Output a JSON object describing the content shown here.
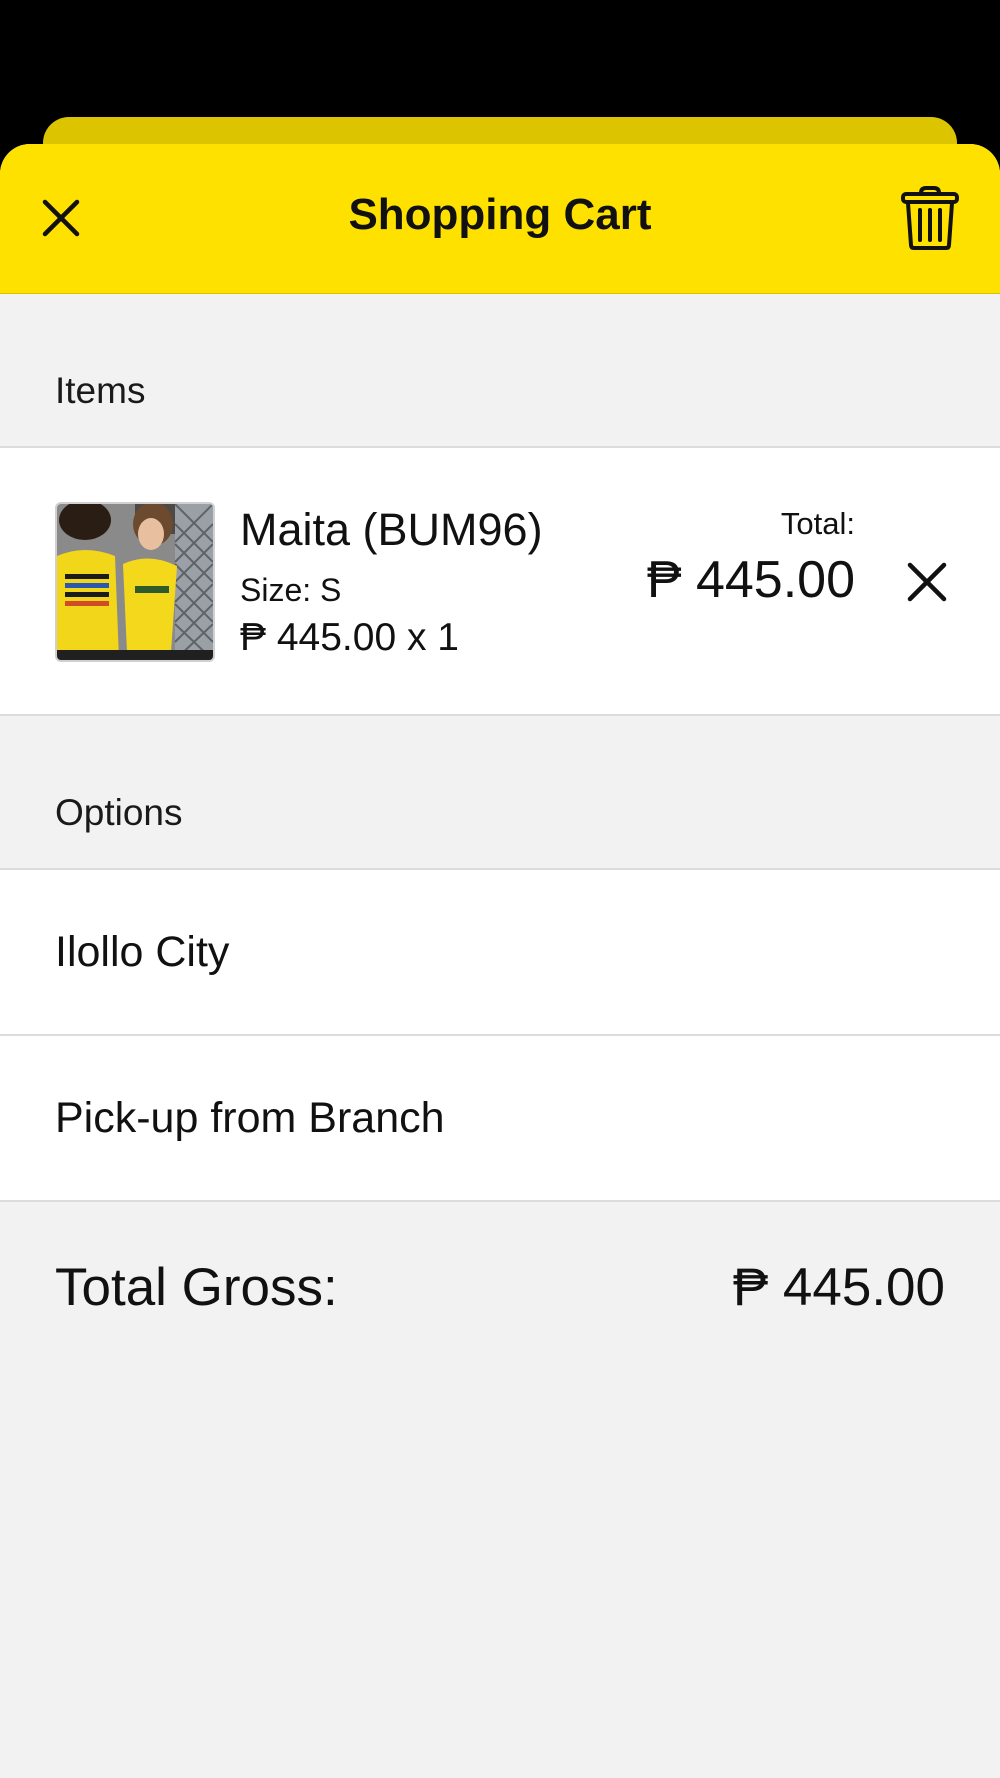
{
  "header": {
    "title": "Shopping Cart"
  },
  "items_section": {
    "label": "Items"
  },
  "cart_items": [
    {
      "name": "Maita (BUM96)",
      "size": "Size: S",
      "price_qty": "₱ 445.00 x 1",
      "total_label": "Total:",
      "total_value": "₱ 445.00"
    }
  ],
  "options_section": {
    "label": "Options",
    "rows": [
      "Ilollo City",
      "Pick-up from Branch"
    ]
  },
  "summary": {
    "gross_label": "Total Gross:",
    "gross_value": "₱ 445.00"
  },
  "colors": {
    "accent": "#ffe100",
    "accent_dark": "#dcc500",
    "background": "#f2f2f2",
    "card": "#ffffff",
    "text": "#111111"
  },
  "icons": [
    "close-icon",
    "trash-icon",
    "remove-item-icon"
  ]
}
